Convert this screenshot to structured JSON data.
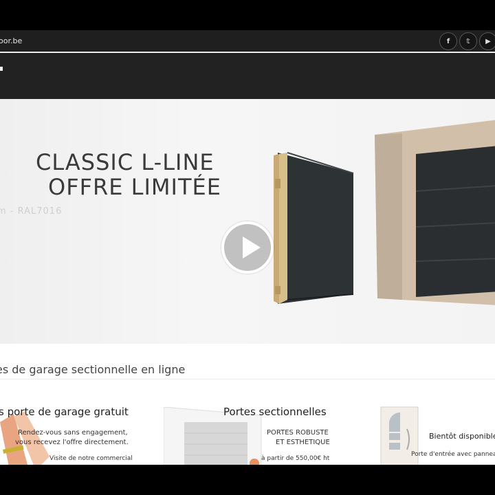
{
  "topbar": {
    "domain_text": "oor.be",
    "social": [
      {
        "icon": "facebook-icon",
        "glyph": "f"
      },
      {
        "icon": "twitter-icon",
        "glyph": "𝕥"
      },
      {
        "icon": "youtube-icon",
        "glyph": "▶"
      }
    ]
  },
  "slider": {
    "title_line1": "CLASSIC L-LINE",
    "title_line2": "OFFRE LIMITÉE",
    "subtitle": "m  -  RAL7016",
    "active_dot": 1,
    "dots": 3
  },
  "section": {
    "title": "es de garage sectionnelle en ligne"
  },
  "cards": [
    {
      "title": "s porte de garage gratuit",
      "line1": "Rendez-vous sans engagement,",
      "line2": "vous recevez l'offre directement.",
      "note": "Visite de notre commercial"
    },
    {
      "title": "Portes sectionnelles",
      "line1": "PORTES ROBUSTE",
      "line2": "ET ESTHETIQUE",
      "note": "à partir de 550,00€ ht"
    },
    {
      "title": "Bientôt disponible",
      "note": "Porte d'entrée avec panneau"
    }
  ],
  "colors": {
    "accent": "#e06a2c",
    "header": "#222222",
    "door_panel": "#2f3437",
    "frame": "#d4c2ad"
  }
}
